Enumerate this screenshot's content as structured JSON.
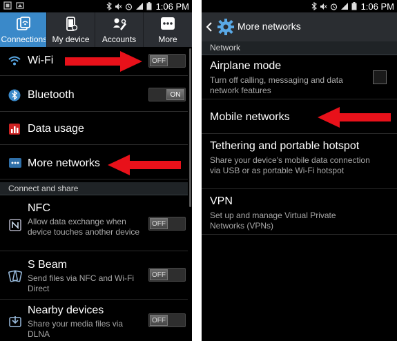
{
  "status": {
    "time": "1:06 PM"
  },
  "left": {
    "tabs": [
      {
        "label": "Connections",
        "icon": "connections-icon"
      },
      {
        "label": "My device",
        "icon": "my-device-icon"
      },
      {
        "label": "Accounts",
        "icon": "accounts-icon"
      },
      {
        "label": "More",
        "icon": "more-icon"
      }
    ],
    "items": {
      "wifi": {
        "title": "Wi-Fi",
        "toggle": "OFF"
      },
      "bluetooth": {
        "title": "Bluetooth",
        "toggle": "ON"
      },
      "data_usage": {
        "title": "Data usage"
      },
      "more_networks": {
        "title": "More networks"
      }
    },
    "section_connect": "Connect and share",
    "nfc": {
      "title": "NFC",
      "subtitle": "Allow data exchange when device touches another device",
      "toggle": "OFF"
    },
    "s_beam": {
      "title": "S Beam",
      "subtitle": "Send files via NFC and Wi-Fi Direct",
      "toggle": "OFF"
    },
    "nearby": {
      "title": "Nearby devices",
      "subtitle": "Share your media files via DLNA",
      "toggle": "OFF"
    }
  },
  "right": {
    "title": "More networks",
    "section_network": "Network",
    "airplane": {
      "title": "Airplane mode",
      "subtitle": "Turn off calling, messaging and data network features"
    },
    "mobile_networks": {
      "title": "Mobile networks"
    },
    "tethering": {
      "title": "Tethering and portable hotspot",
      "subtitle": "Share your device's mobile data connection via USB or as portable Wi-Fi hotspot"
    },
    "vpn": {
      "title": "VPN",
      "subtitle": "Set up and manage Virtual Private Networks (VPNs)"
    }
  },
  "colors": {
    "accent": "#3a89c9",
    "arrow": "#e8111a"
  }
}
